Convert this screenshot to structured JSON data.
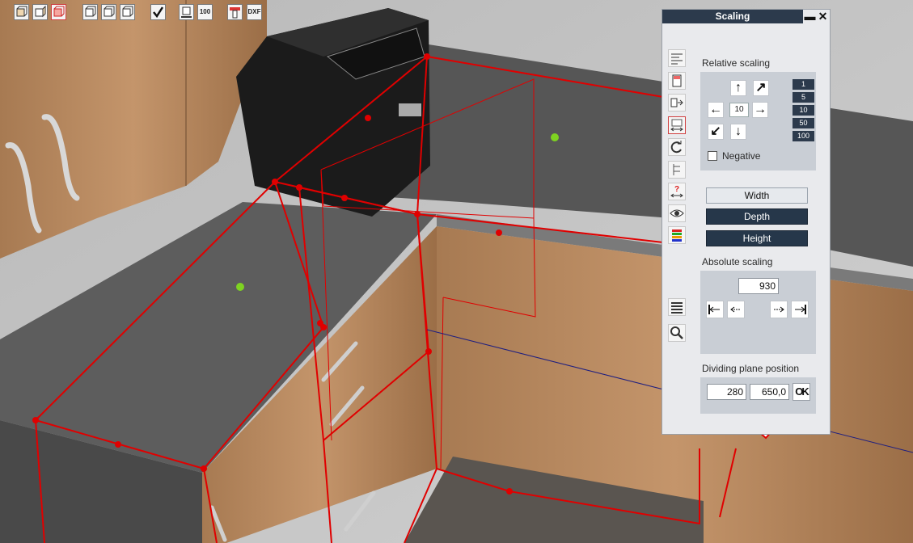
{
  "toolbar": {
    "dxf_label": "DXF",
    "measure_label": "100"
  },
  "panel": {
    "title": "Scaling",
    "minimize_glyph": "▬",
    "close_glyph": "✕",
    "relative": {
      "label": "Relative scaling",
      "step_value": "10",
      "steps": [
        "1",
        "5",
        "10",
        "50",
        "100"
      ],
      "negative_label": "Negative"
    },
    "directions": {
      "width": "Width",
      "depth": "Depth",
      "height": "Height",
      "width_selected": false,
      "depth_selected": true,
      "height_selected": true
    },
    "absolute": {
      "label": "Absolute scaling",
      "value": "930"
    },
    "dividing": {
      "label": "Dividing plane position",
      "value1": "280",
      "value2": "650,0",
      "ok_label": "OK"
    }
  },
  "colors": {
    "outline": "#e00000",
    "panel_title": "#2c3a4c",
    "dark_button": "#26374a",
    "marker_green": "#7ed321"
  }
}
